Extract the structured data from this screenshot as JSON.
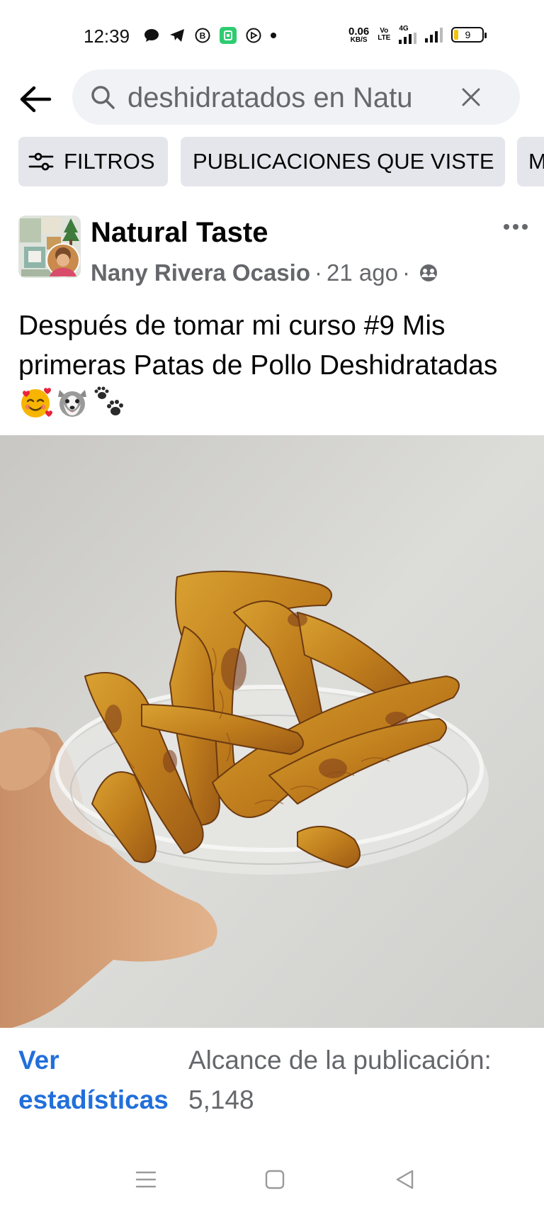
{
  "status_bar": {
    "time": "12:39",
    "left_icons": [
      "chat-bubble-icon",
      "telegram-icon",
      "b-circle-icon",
      "green-app-icon",
      "whatsapp-icon"
    ],
    "speed_value": "0.06",
    "speed_unit": "KB/S",
    "volte_line1": "Vo",
    "volte_line2": "LTE",
    "network_type": "4G",
    "battery_level": "9",
    "battery_color": "#f1c40f"
  },
  "search": {
    "query": "deshidratados en Natu"
  },
  "filters": {
    "filters_label": "FILTROS",
    "viewed_label": "PUBLICACIONES QUE VISTE",
    "more_label": "M"
  },
  "post": {
    "page_name": "Natural Taste",
    "author": "Nany Rivera Ocasio",
    "separator": "·",
    "date": "21 ago",
    "text": "Después de tomar mi curso #9 Mis primeras Patas de Pollo Deshidratadas",
    "emojis": [
      "smiling-face-with-hearts",
      "dog-face",
      "paw-prints"
    ]
  },
  "insights": {
    "link_label": "Ver estadísticas",
    "reach_label": "Alcance de la publicación:",
    "reach_value": "5,148"
  },
  "colors": {
    "link": "#216fdb",
    "secondary_text": "#65676b",
    "chip_bg": "#e4e6eb",
    "search_bg": "#f0f2f5"
  }
}
